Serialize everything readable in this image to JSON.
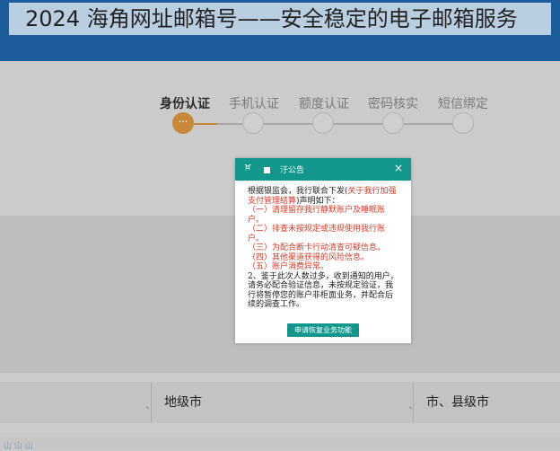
{
  "page": {
    "title": "2024 海角网址邮箱号——安全稳定的电子邮箱服务"
  },
  "steps": [
    {
      "label": "身份认证",
      "active": true,
      "marker": "···"
    },
    {
      "label": "手机认证",
      "active": false
    },
    {
      "label": "额度认证",
      "active": false
    },
    {
      "label": "密码核实",
      "active": false
    },
    {
      "label": "短信绑定",
      "active": false
    }
  ],
  "modal": {
    "icon_char": "ਖ਼",
    "title": "汙公告",
    "close": "×",
    "intro_prefix": "根据银监会，我行联合下发(",
    "intro_red": "关于我行加强支付管理结算",
    "intro_suffix": ")声明如下：",
    "items": [
      "（一）清理留存我行静默账户及睡眠账户。",
      "（二）排查未按规定或违规使用我行账户。",
      "（三）为配合断卡行动清查可疑信息。",
      "（四）其他渠道获得的风险信息。",
      "（五）账户消费异常。"
    ],
    "notice": "2、鉴于此次人数过多，收到通知的用户，请务必配合验证信息，未按规定验证，我行将暂停您的账户非柜面业务，并配合后续的调查工作。",
    "button": "申请恢复业务功能"
  },
  "selects": {
    "city": "地级市",
    "county": "市、县级市"
  },
  "footer": {
    "text": "山 山 山"
  },
  "colors": {
    "topbar": "#1d5d9b",
    "accent": "#13978c",
    "step_active": "#c8883a",
    "notice_red": "#d63a2b"
  }
}
